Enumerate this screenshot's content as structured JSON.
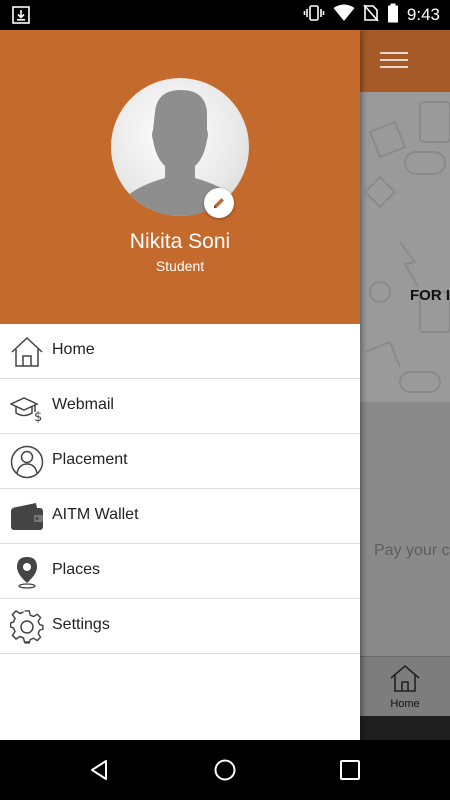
{
  "status_bar": {
    "time": "9:43",
    "icons": [
      "download-icon",
      "vibrate-icon",
      "wifi-icon",
      "no-sim-icon",
      "battery-icon"
    ]
  },
  "background_app": {
    "banner_text": "FOR I",
    "pay_text": "Pay your c",
    "bottom_nav": {
      "home_label": "Home"
    }
  },
  "drawer": {
    "header": {
      "name": "Nikita Soni",
      "role": "Student",
      "background_color": "#c56a2d"
    },
    "menu_items": [
      {
        "label": "Home",
        "icon": "home-icon"
      },
      {
        "label": "Webmail",
        "icon": "graduation-cap-icon"
      },
      {
        "label": "Placement",
        "icon": "person-circle-icon"
      },
      {
        "label": "AITM Wallet",
        "icon": "wallet-icon"
      },
      {
        "label": "Places",
        "icon": "location-pin-icon"
      },
      {
        "label": "Settings",
        "icon": "gear-icon"
      }
    ]
  },
  "nav_bar": {
    "buttons": [
      "back-icon",
      "home-circle-icon",
      "recents-icon"
    ]
  }
}
